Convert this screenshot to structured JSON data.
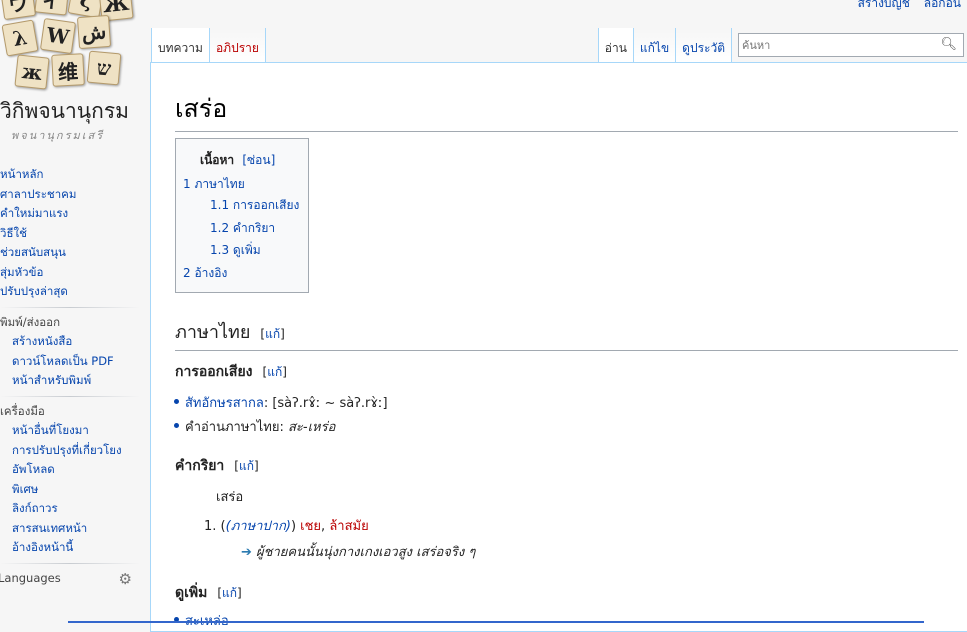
{
  "personal": {
    "create_account": "สร้างบัญชี",
    "login": "ล็อกอิน"
  },
  "logo": {
    "tiles": [
      "ウ",
      "ィ",
      "Ж",
      "ξ",
      "λ",
      "W",
      "ش",
      "ж",
      "维",
      "ש"
    ],
    "title": "วิกิพจนานุกรม",
    "tagline": "พจนานุกรมเสรี"
  },
  "sidebar": {
    "nav": [
      "หน้าหลัก",
      "ศาลาประชาคม",
      "คำใหม่มาแรง",
      "วิธีใช้",
      "ช่วยสนับสนุน",
      "สุ่มหัวข้อ",
      "ปรับปรุงล่าสุด"
    ],
    "print_head": "พิมพ์/ส่งออก",
    "print": [
      "สร้างหนังสือ",
      "ดาวน์โหลดเป็น PDF",
      "หน้าสำหรับพิมพ์"
    ],
    "tools_head": "เครื่องมือ",
    "tools": [
      "หน้าอื่นที่โยงมา",
      "การปรับปรุงที่เกี่ยวโยง",
      "อัพโหลด",
      "พิเศษ",
      "ลิงก์ถาวร",
      "สารสนเทศหน้า",
      "อ้างอิงหน้านี้"
    ],
    "languages": "Languages"
  },
  "tabs": {
    "article": "บทความ",
    "discussion": "อภิปราย",
    "read": "อ่าน",
    "edit": "แก้ไข",
    "history": "ดูประวัติ"
  },
  "search": {
    "placeholder": "ค้นหา"
  },
  "page": {
    "title": "เสร่อ",
    "toc": {
      "title": "เนื้อหา",
      "toggle": "[ซ่อน]",
      "items": [
        {
          "num": "1",
          "label": "ภาษาไทย"
        },
        {
          "num": "1.1",
          "label": "การออกเสียง"
        },
        {
          "num": "1.2",
          "label": "คำกริยา"
        },
        {
          "num": "1.3",
          "label": "ดูเพิ่ม"
        },
        {
          "num": "2",
          "label": "อ้างอิง"
        }
      ]
    },
    "edit_label": "แก้",
    "lang_heading": "ภาษาไทย",
    "pron_heading": "การออกเสียง",
    "ipa_label": "สัทอักษรสากล",
    "ipa_value": ": [sàʔ.rɤ̂ː ~ sàʔ.rɤ̀ː]",
    "reading_label": "คำอ่านภาษาไทย: ",
    "reading_value": "สะ-เหร่อ",
    "verb_heading": "คำกริยา",
    "headword": "เสร่อ",
    "def_num": "1.",
    "def_tag": "(ภาษาปาก)",
    "def_sense1": "เชย",
    "def_sense2": "ล้าสมัย",
    "example": "ผู้ชายคนนั้นนุ่งกางเกงเอวสูง เสร่อจริง ๆ",
    "see_also_heading": "ดูเพิ่ม",
    "see_also_item": "สะเหล่อ"
  },
  "colors": {
    "link": "#0645ad",
    "redlink": "#ba0000",
    "border": "#a7d7f9"
  }
}
